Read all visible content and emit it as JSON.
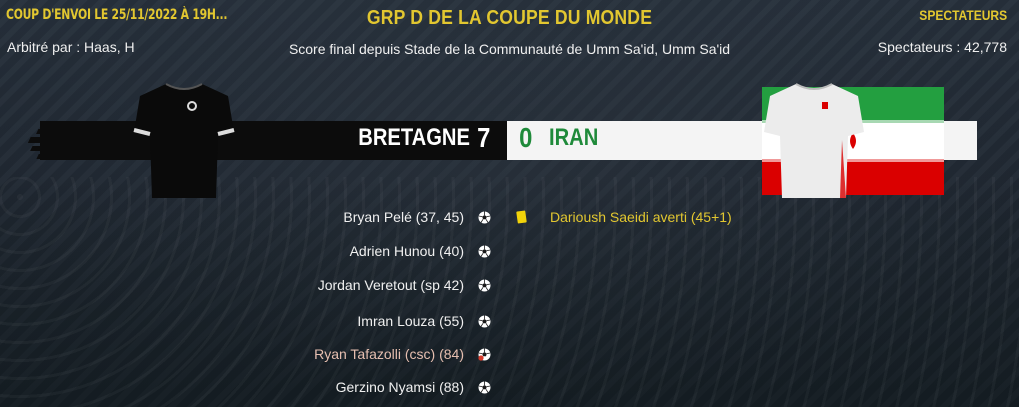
{
  "header": {
    "kickoff": "COUP D'ENVOI LE 25/11/2022 À 19H...",
    "referee": "Arbitré par : Haas, H",
    "competition": "GRP D DE LA COUPE DU MONDE",
    "result_line": "Score final depuis Stade de la Communauté de Umm Sa'id, Umm Sa'id",
    "spectators_heading": "SPECTATEURS",
    "spectators": "Spectateurs : 42,778"
  },
  "match": {
    "home_team": "BRETAGNE",
    "home_score": "7",
    "away_score": "0",
    "away_team": "IRAN",
    "home_shirt_color": "#0a0a0a",
    "away_shirt_color": "#ececec",
    "flag_colors": [
      "#239f40",
      "#ffffff",
      "#da0000"
    ]
  },
  "home_events": [
    {
      "text": "Bryan Pelé (37, 45)",
      "icon": "goal-ball-icon"
    },
    {
      "text": "Adrien Hunou (40)",
      "icon": "goal-ball-icon"
    },
    {
      "text": "Jordan Veretout (sp 42)",
      "icon": "goal-ball-icon"
    },
    {
      "text": "Imran Louza (55)",
      "icon": "goal-ball-icon"
    },
    {
      "text": "Ryan Tafazolli (csc) (84)",
      "icon": "own-goal-ball-icon"
    },
    {
      "text": "Gerzino Nyamsi (88)",
      "icon": "goal-ball-icon"
    }
  ],
  "away_events": [
    {
      "text": "Darioush Saeidi averti (45+1)",
      "icon": "yellow-card-icon"
    }
  ],
  "colors": {
    "accent": "#e2c730",
    "away_green": "#1f8a3a",
    "yellow_card": "#f2d30a"
  }
}
